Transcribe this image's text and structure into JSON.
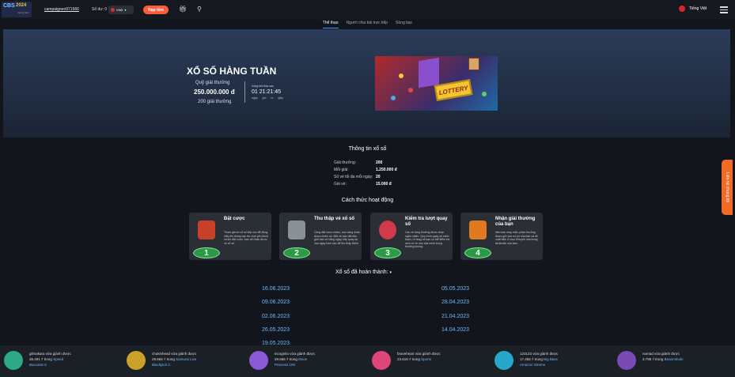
{
  "header": {
    "logo_line1": "CBS",
    "logo_line2": "2024",
    "logo_line3": "Vieng Nam",
    "username": "campaignen971566",
    "balance_label": "Số dư: 0",
    "currency": "VND",
    "deposit_label": "Nạp tiền",
    "language": "Tiếng Việt"
  },
  "tabs": [
    {
      "label": "Thể thao",
      "active": true
    },
    {
      "label": "Người chia bài trực tiếp",
      "active": false
    },
    {
      "label": "Sòng bạc",
      "active": false
    }
  ],
  "banner": {
    "title": "XỔ SỐ HÀNG TUẦN",
    "prize_pool_label": "Quỹ giải thưởng",
    "prize_pool": "250.000.000 đ",
    "prize_count": "200 giải thưởng",
    "round_label": "Vòng kết thúc sau",
    "countdown": "01 21:21:45",
    "units": "ngày giờ m giây",
    "lottery_sign": "LOTTERY"
  },
  "info": {
    "title": "Thông tin xổ số",
    "rows": [
      {
        "k": "Giải thưởng:",
        "v": "200"
      },
      {
        "k": "Mỗi giải:",
        "v": "1.250.000 đ"
      },
      {
        "k": "Số vé tối đa mỗi ngày:",
        "v": "20"
      },
      {
        "k": "Giá vé:",
        "v": "15.000 đ"
      }
    ]
  },
  "how": {
    "title": "Cách thức hoạt động",
    "cards": [
      {
        "title": "Đặt cược",
        "desc": "Tham gia về xổ số tiếp xúc để đồng. Hãy lên tháng các trò chơi yêu thích và khi đặt cược, bạn sẽ nhận được vé xổ số.",
        "num": "1",
        "color": "#c9402a"
      },
      {
        "title": "Thu thập vé xổ số",
        "desc": "Càng đặt cược nhiều, bạn càng nhận được nhiều vé. Mỗi vé bạn đặt đều giới hạn về hằng ngày, hãy quay lại vào ngày hôm sau để thu thập thêm.",
        "num": "2",
        "color": "#8a8f98"
      },
      {
        "title": "Kiểm tra lượt quay số",
        "desc": "Các vé từng thưởng được chọn ngẫu nhiên. Quy trình quay số minh bạch, rõ ràng và bạn có thể kiểm tra xem có vé nào của mình trúng thưởng không.",
        "num": "3",
        "color": "#d23a4a"
      },
      {
        "title": "Nhận giải thưởng của bạn",
        "desc": "Nếu bạn may mắn, phần thưởng được gửi vào số dư của bạn và sẽ xuất hiện ở mục Khuyến mại trong tài khoản của bạn.",
        "num": "4",
        "color": "#e07a20"
      }
    ]
  },
  "completed": {
    "title": "Xổ số đã hoàn thành:",
    "left": [
      "16.06.2023",
      "09.06.2023",
      "02.06.2023",
      "26.05.2023",
      "19.05.2023"
    ],
    "right": [
      "05.05.2023",
      "28.04.2023",
      "21.04.2023",
      "14.04.2023"
    ]
  },
  "side_tab": "Liên hệ chúng tôi",
  "ticker": [
    {
      "user": "gilmakara vừa giành được",
      "amount": "35.491 ₫",
      "in": "trong",
      "game": "Speed",
      "game2": "Baccarat X",
      "color": "#2fa88a"
    },
    {
      "user": "chukinhead vừa giành được",
      "amount": "29.666 ₫",
      "in": "trong",
      "game": "Samurai Live",
      "game2": "Blackjack C",
      "color": "#c9a22a"
    },
    {
      "user": "incognito vừa giành được",
      "amount": "29.666 ₫",
      "in": "trong",
      "game": "Moon",
      "game2": "Princess 100",
      "color": "#8a5ad6"
    },
    {
      "user": "braveheart vừa giành được",
      "amount": "23.619 ₫",
      "in": "trong",
      "game": "Sports",
      "game2": "",
      "color": "#e0457a"
    },
    {
      "user": "123123 vừa giành được",
      "amount": "17.455 ₫",
      "in": "trong",
      "game": "Big Bass",
      "game2": "Amazon Xtreme",
      "color": "#27a7c8"
    },
    {
      "user": "nomad vừa giành được",
      "amount": "3.795 ₫",
      "in": "trong",
      "game": "Beast Mode",
      "game2": "",
      "color": "#7a4ab0"
    }
  ]
}
